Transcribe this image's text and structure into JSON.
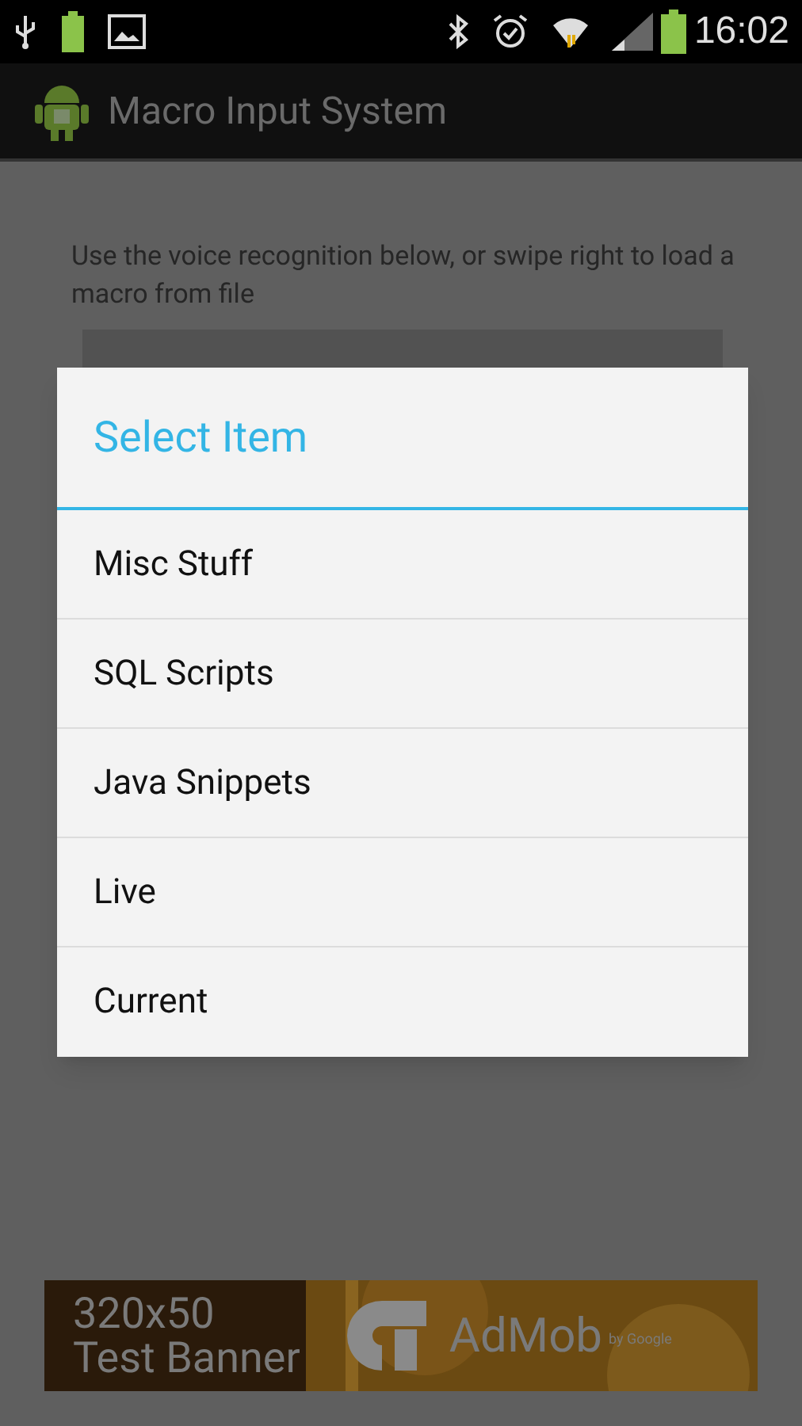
{
  "status_bar": {
    "time": "16:02"
  },
  "action_bar": {
    "title": "Macro Input System"
  },
  "instructions": "Use the voice recognition below, or swipe right to load a macro from file",
  "dialog": {
    "title": "Select Item",
    "items": [
      {
        "label": "Misc Stuff"
      },
      {
        "label": "SQL Scripts"
      },
      {
        "label": "Java Snippets"
      },
      {
        "label": "Live"
      },
      {
        "label": "Current"
      }
    ]
  },
  "ad_banner": {
    "size": "320x50",
    "label": "Test Banner",
    "brand": "AdMob",
    "byline": "by Google"
  }
}
